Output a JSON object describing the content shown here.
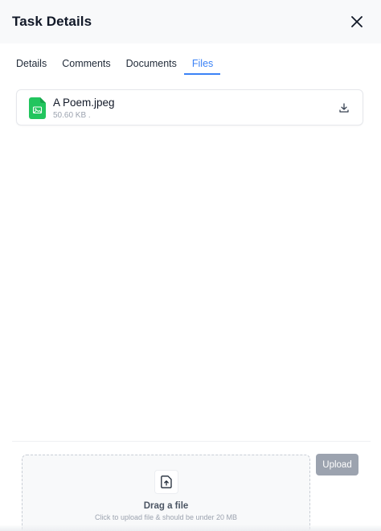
{
  "header": {
    "title": "Task Details",
    "close_icon": "close-icon"
  },
  "tabs": [
    {
      "label": "Details",
      "active": false
    },
    {
      "label": "Comments",
      "active": false
    },
    {
      "label": "Documents",
      "active": false
    },
    {
      "label": "Files",
      "active": true
    }
  ],
  "files": [
    {
      "name": "A Poem.jpeg",
      "meta": "50.60 KB .",
      "icon": "image-file-icon",
      "icon_color": "#22c55e",
      "action_icon": "download-icon"
    }
  ],
  "upload": {
    "icon": "file-upload-icon",
    "title": "Drag a file",
    "subtitle": "Click to upload file & should be under 20 MB",
    "button_label": "Upload"
  },
  "colors": {
    "accent": "#3b82f6",
    "upload_button_disabled": "#9ca3af"
  }
}
